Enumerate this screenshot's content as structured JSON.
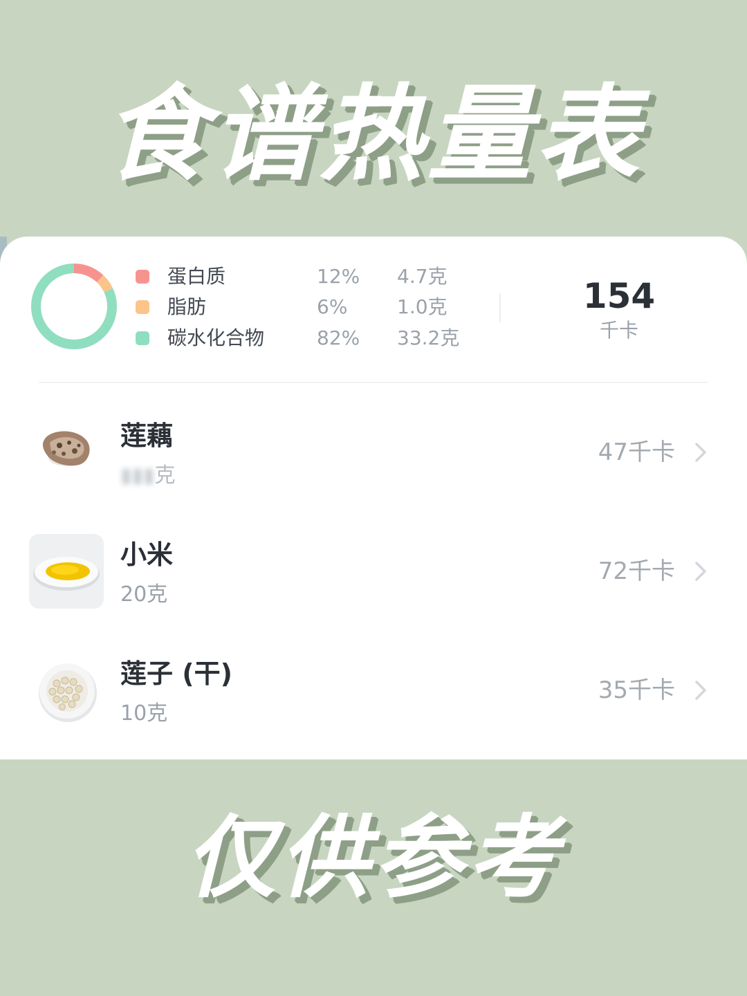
{
  "header": {
    "title": "食谱热量表"
  },
  "footer": {
    "title": "仅供参考"
  },
  "colors": {
    "background": "#c8d6c1",
    "protein": "#f7938e",
    "fat": "#fbc489",
    "carbs": "#8fdec0"
  },
  "summary": {
    "macros": [
      {
        "name": "蛋白质",
        "percent": "12%",
        "amount": "4.7克",
        "color": "#f7938e"
      },
      {
        "name": "脂肪",
        "percent": "6%",
        "amount": "1.0克",
        "color": "#fbc489"
      },
      {
        "name": "碳水化合物",
        "percent": "82%",
        "amount": "33.2克",
        "color": "#8fdec0"
      }
    ],
    "donut_fractions": [
      0.12,
      0.06,
      0.82
    ],
    "total_kcal": "154",
    "total_unit": "千卡"
  },
  "foods": [
    {
      "name": "莲藕",
      "weight_unit": "克",
      "kcal": "47千卡",
      "icon": "lotus-root-image"
    },
    {
      "name": "小米",
      "weight": "20克",
      "kcal": "72千卡",
      "icon": "millet-plate-image"
    },
    {
      "name": "莲子 (干)",
      "weight": "10克",
      "kcal": "35千卡",
      "icon": "lotus-seed-bowl-image"
    }
  ]
}
